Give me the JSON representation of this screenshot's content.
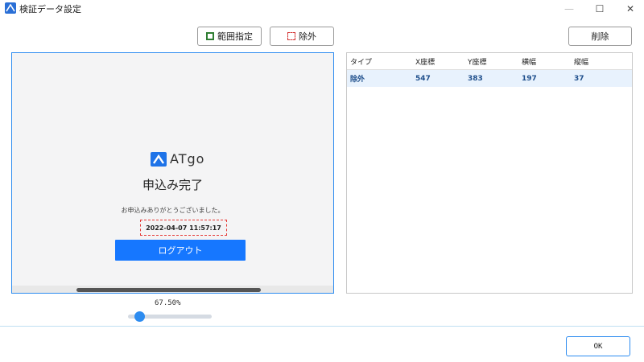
{
  "window": {
    "title": "検証データ設定",
    "minimize_glyph": "—",
    "maximize_glyph": "☐",
    "close_glyph": "✕"
  },
  "toolbar": {
    "range_label": "範囲指定",
    "exclude_label": "除外",
    "delete_label": "削除"
  },
  "preview": {
    "logo_text": "ATgo",
    "heading": "申込み完了",
    "thanks": "お申込みありがとうございました。",
    "timestamp": "2022-04-07 11:57:17",
    "logout_label": "ログアウト"
  },
  "zoom": {
    "label": "67.50%",
    "value": 0.675
  },
  "table": {
    "headers": [
      "タイプ",
      "X座標",
      "Y座標",
      "横幅",
      "縦幅"
    ],
    "rows": [
      [
        "除外",
        "547",
        "383",
        "197",
        "37"
      ]
    ]
  },
  "footer": {
    "ok_label": "OK"
  },
  "colors": {
    "accent": "#2d8cf0",
    "logout_button": "#1677ff",
    "range_marker": "#2e7d32",
    "exclude_marker": "#d32f2f",
    "selected_row": "#e8f2fd"
  },
  "icons": {
    "app": "atgo-logo-icon",
    "range": "green-square-icon",
    "exclude": "red-dashed-square-icon"
  }
}
